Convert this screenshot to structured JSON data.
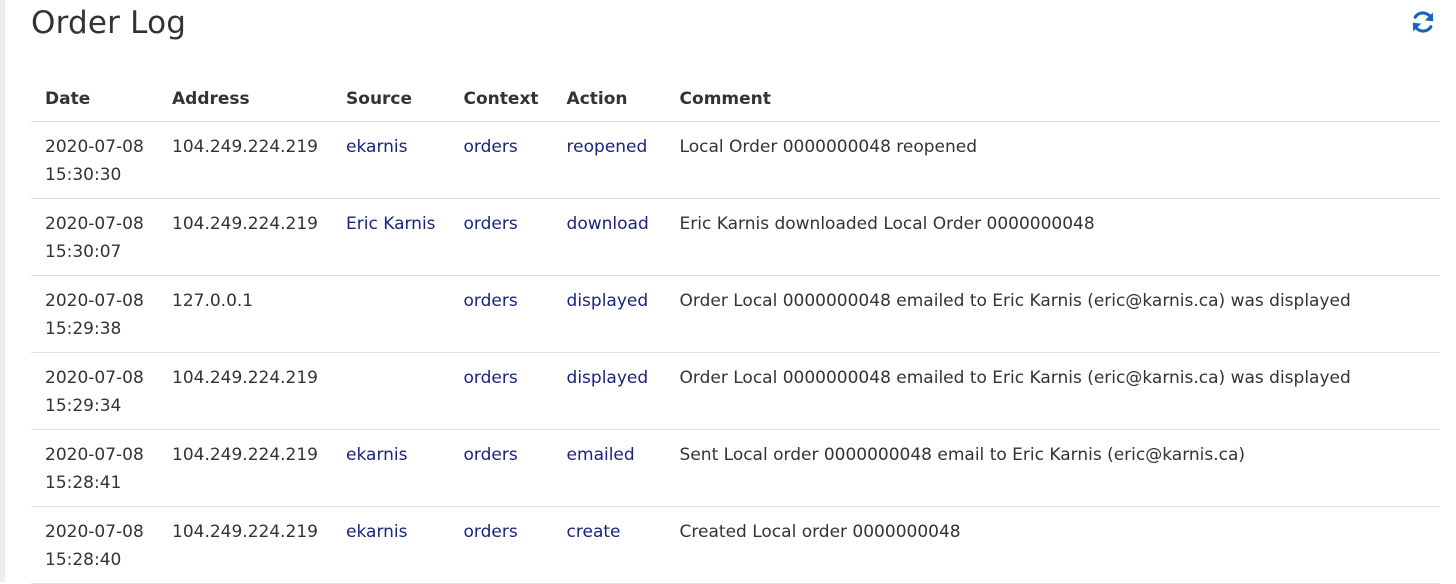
{
  "page": {
    "title": "Order Log",
    "refresh_icon": "refresh-icon",
    "accent_color": "#1565c0",
    "link_color": "#1a237e"
  },
  "table": {
    "headers": {
      "date": "Date",
      "address": "Address",
      "source": "Source",
      "context": "Context",
      "action": "Action",
      "comment": "Comment"
    },
    "rows": [
      {
        "date": "2020-07-08",
        "time": "15:30:30",
        "address": "104.249.224.219",
        "source": "ekarnis",
        "context": "orders",
        "action": "reopened",
        "comment": "Local Order 0000000048 reopened"
      },
      {
        "date": "2020-07-08",
        "time": "15:30:07",
        "address": "104.249.224.219",
        "source": "Eric Karnis",
        "context": "orders",
        "action": "download",
        "comment": "Eric Karnis downloaded Local Order 0000000048"
      },
      {
        "date": "2020-07-08",
        "time": "15:29:38",
        "address": "127.0.0.1",
        "source": "",
        "context": "orders",
        "action": "displayed",
        "comment": "Order Local 0000000048 emailed to Eric Karnis (eric@karnis.ca) was displayed"
      },
      {
        "date": "2020-07-08",
        "time": "15:29:34",
        "address": "104.249.224.219",
        "source": "",
        "context": "orders",
        "action": "displayed",
        "comment": "Order Local 0000000048 emailed to Eric Karnis (eric@karnis.ca) was displayed"
      },
      {
        "date": "2020-07-08",
        "time": "15:28:41",
        "address": "104.249.224.219",
        "source": "ekarnis",
        "context": "orders",
        "action": "emailed",
        "comment": "Sent Local order 0000000048 email to Eric Karnis (eric@karnis.ca)"
      },
      {
        "date": "2020-07-08",
        "time": "15:28:40",
        "address": "104.249.224.219",
        "source": "ekarnis",
        "context": "orders",
        "action": "create",
        "comment": "Created Local order 0000000048"
      }
    ]
  }
}
